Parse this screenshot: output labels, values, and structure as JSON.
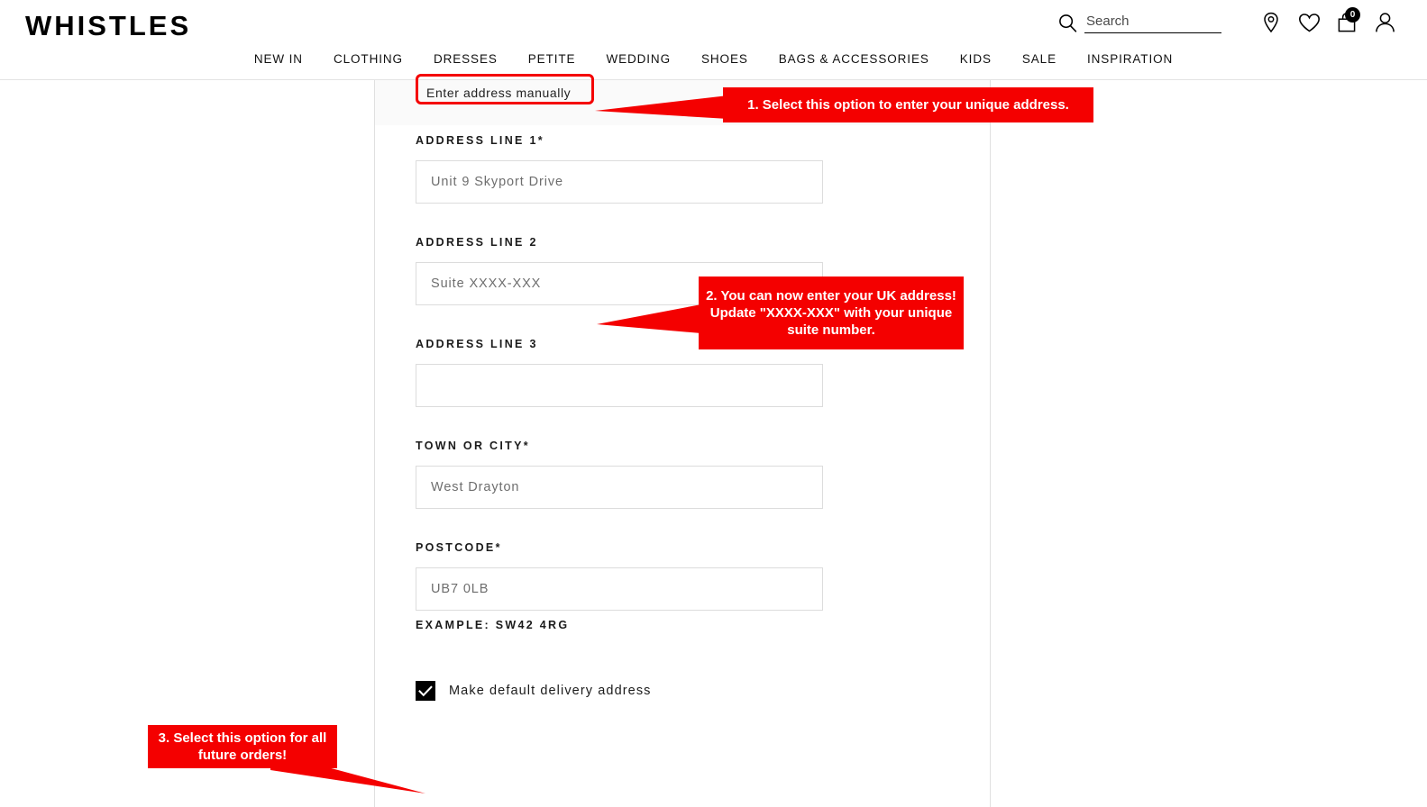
{
  "header": {
    "logo": "WHISTLES",
    "search": {
      "placeholder": "Search",
      "value": "",
      "icon": "search-icon"
    },
    "icons": [
      {
        "name": "store-locator-icon",
        "glyph": "location-pin"
      },
      {
        "name": "wishlist-icon",
        "glyph": "heart"
      },
      {
        "name": "bag-icon",
        "glyph": "shopping-bag",
        "badge": "0"
      },
      {
        "name": "account-icon",
        "glyph": "person"
      }
    ],
    "nav": [
      {
        "label": "NEW IN"
      },
      {
        "label": "CLOTHING"
      },
      {
        "label": "DRESSES"
      },
      {
        "label": "PETITE"
      },
      {
        "label": "WEDDING"
      },
      {
        "label": "SHOES"
      },
      {
        "label": "BAGS & ACCESSORIES"
      },
      {
        "label": "KIDS"
      },
      {
        "label": "SALE"
      },
      {
        "label": "INSPIRATION"
      }
    ]
  },
  "form": {
    "manual_link": "Enter address manually",
    "fields": [
      {
        "label": "ADDRESS LINE 1",
        "required": "*",
        "placeholder": "Unit 9 Skyport Drive",
        "value": "",
        "name": "address-line-1"
      },
      {
        "label": "ADDRESS LINE 2",
        "required": "",
        "placeholder": "Suite XXXX-XXX",
        "value": "",
        "name": "address-line-2"
      },
      {
        "label": "ADDRESS LINE 3",
        "required": "",
        "placeholder": "",
        "value": "",
        "name": "address-line-3"
      },
      {
        "label": "TOWN OR CITY",
        "required": "*",
        "placeholder": "West Drayton",
        "value": "",
        "name": "town-or-city"
      },
      {
        "label": "POSTCODE",
        "required": "*",
        "placeholder": "UB7 0LB",
        "value": "",
        "name": "postcode"
      }
    ],
    "postcode_example": "EXAMPLE: SW42 4RG",
    "default_address": {
      "label": "Make default delivery address",
      "checked": true
    }
  },
  "annotations": [
    {
      "id": 1,
      "text": "1. Select this option to enter your unique address.",
      "color": "#f40000",
      "points_to": "manual-address-link"
    },
    {
      "id": 2,
      "text": "2. You can now enter your UK address! Update \"XXXX-XXX\" with your unique suite number.",
      "color": "#f40000",
      "points_to": "address-line-2-input"
    },
    {
      "id": 3,
      "text": "3. Select this option for all future orders!",
      "color": "#f40000",
      "points_to": "default-address-checkbox"
    }
  ],
  "colors": {
    "annotation_red": "#f40000",
    "text_dark": "#1b1b1b",
    "placeholder_gray": "#6e6e6e",
    "border_gray": "#dcdcdc"
  }
}
